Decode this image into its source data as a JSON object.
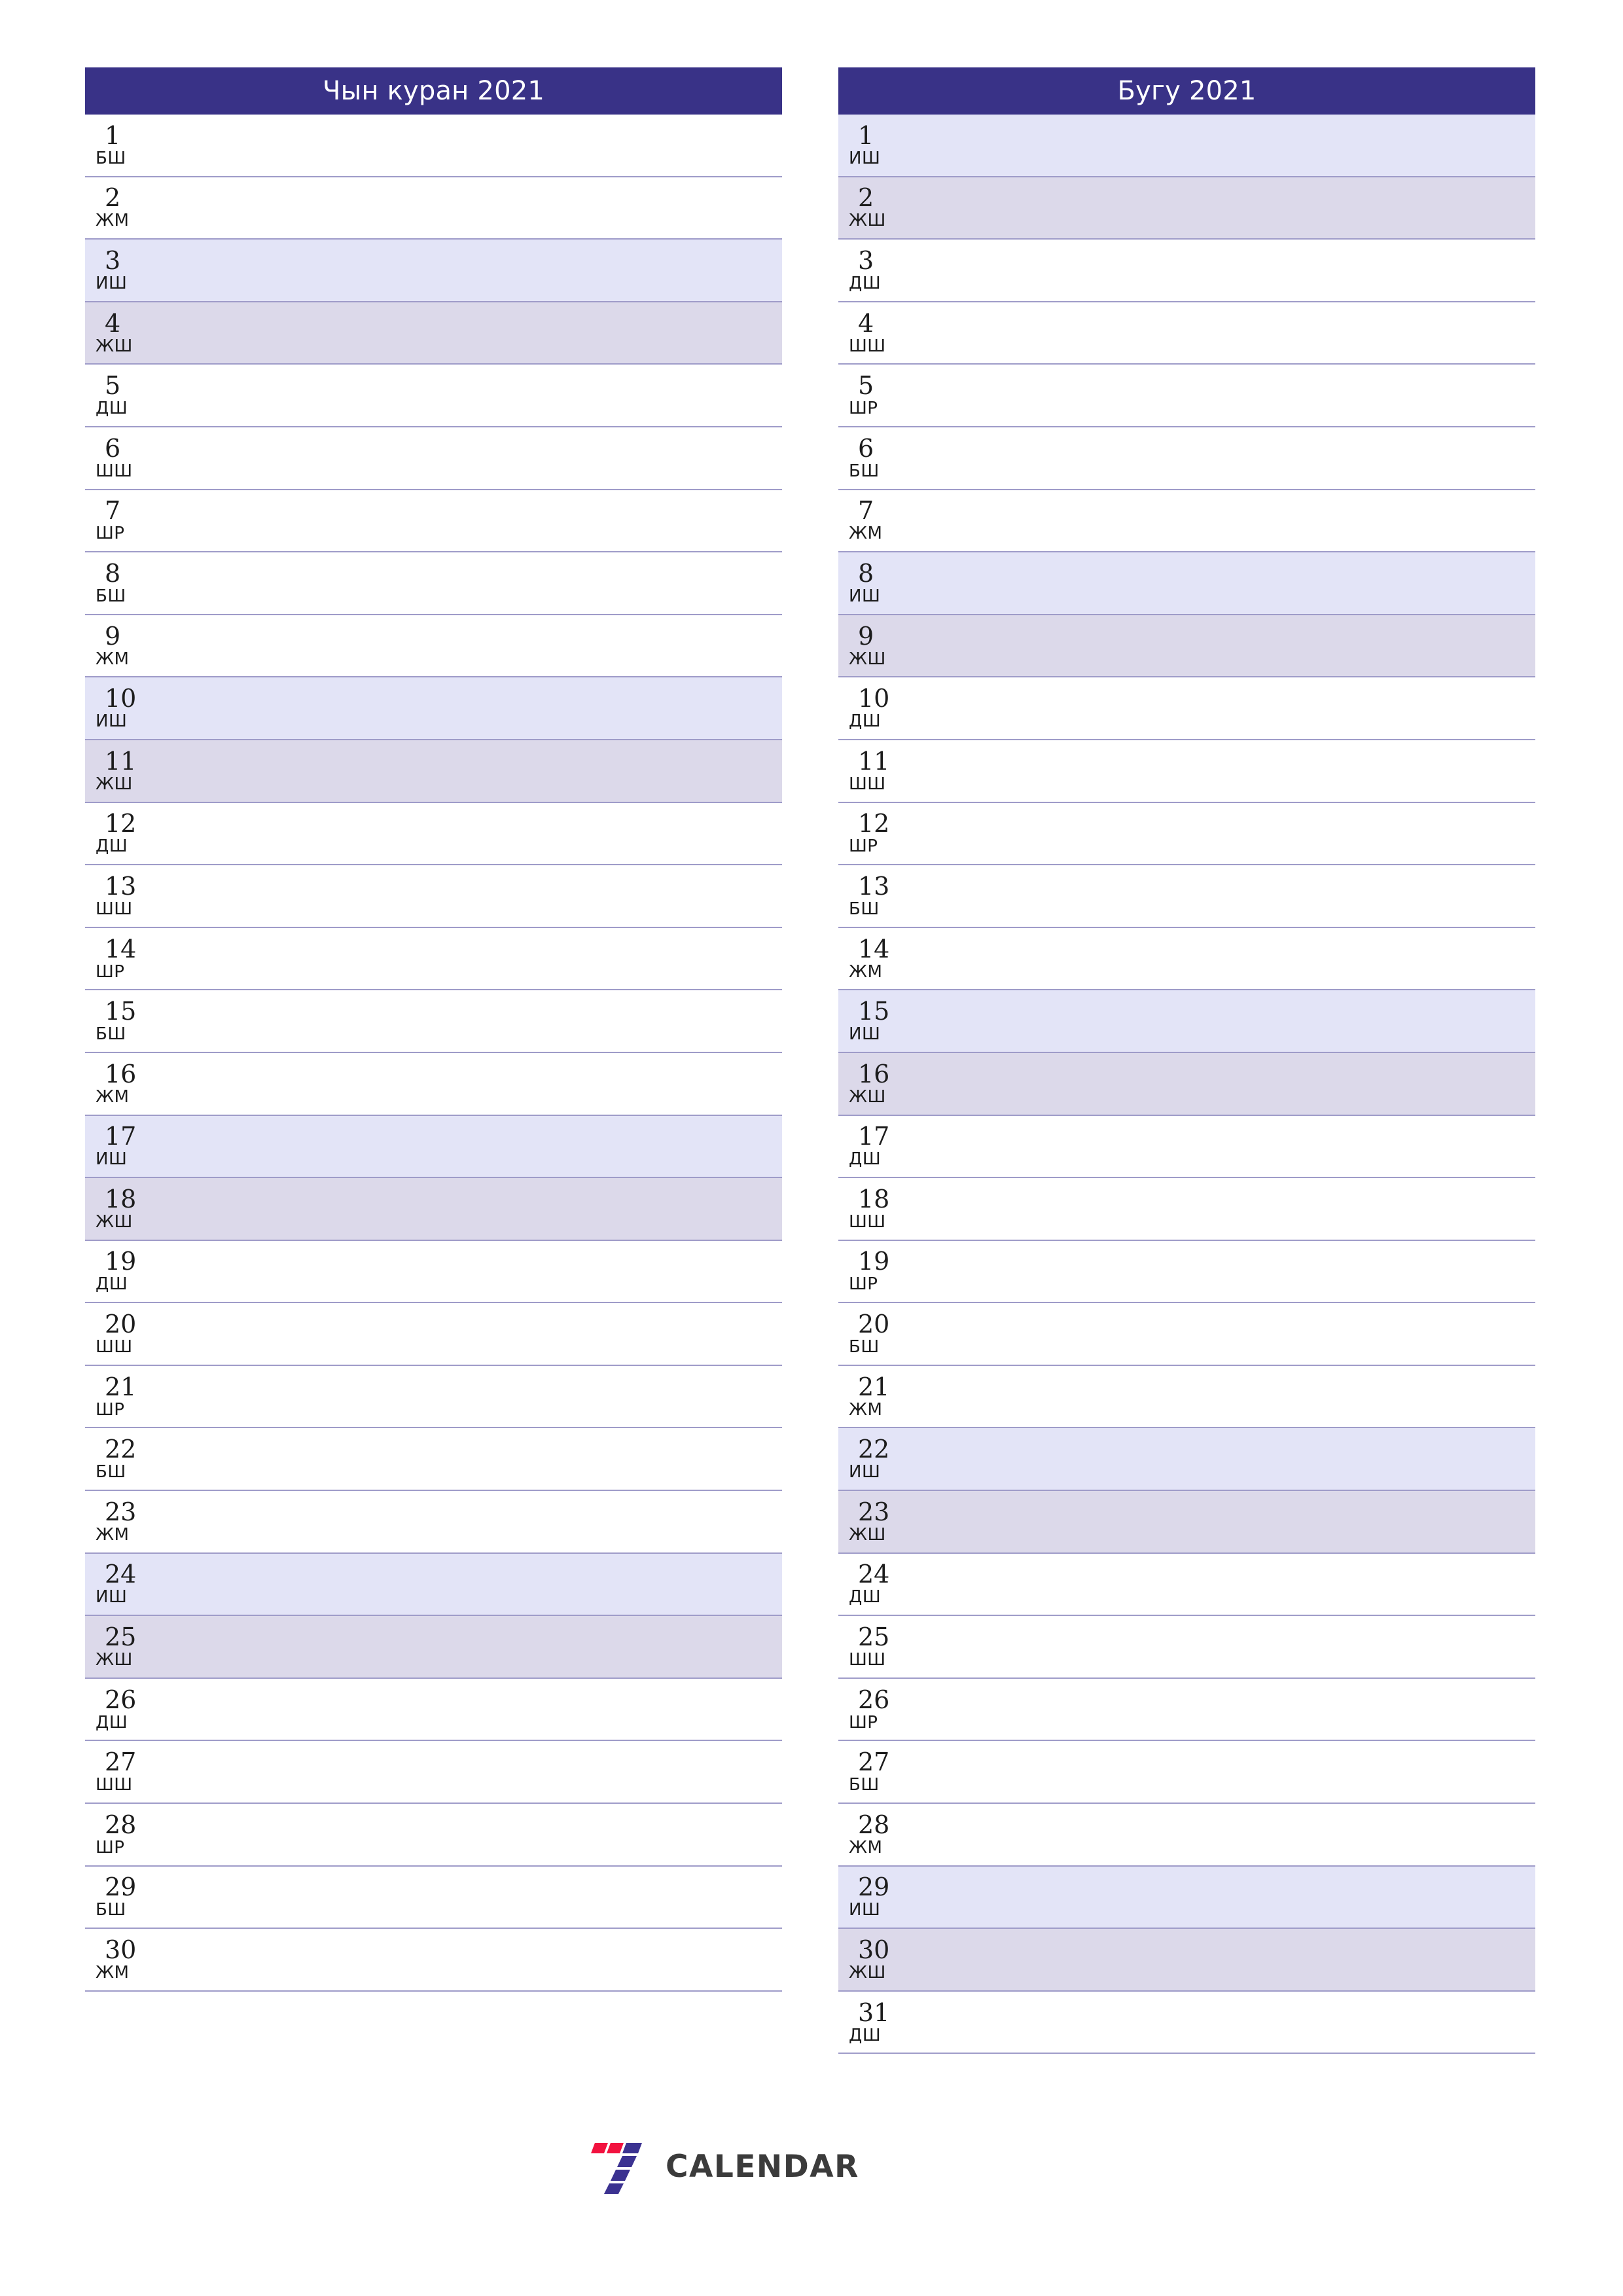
{
  "brand": {
    "name": "CALENDAR",
    "mark_icon": "seven-logo-icon",
    "mark_colors": {
      "red": "#f2123f",
      "blue": "#3b3291"
    }
  },
  "theme": {
    "header_bg": "#393287",
    "header_text": "#ffffff",
    "saturday_bg": "#e3e4f7",
    "sunday_bg": "#dcd9ea",
    "row_border": "#9f9cc9",
    "text": "#1c1c1c"
  },
  "months": [
    {
      "title": "Чын куран 2021",
      "days": [
        {
          "num": "1",
          "wd": "БШ",
          "type": "work"
        },
        {
          "num": "2",
          "wd": "ЖМ",
          "type": "work"
        },
        {
          "num": "3",
          "wd": "ИШ",
          "type": "sat"
        },
        {
          "num": "4",
          "wd": "ЖШ",
          "type": "sun"
        },
        {
          "num": "5",
          "wd": "ДШ",
          "type": "work"
        },
        {
          "num": "6",
          "wd": "ШШ",
          "type": "work"
        },
        {
          "num": "7",
          "wd": "ШР",
          "type": "work"
        },
        {
          "num": "8",
          "wd": "БШ",
          "type": "work"
        },
        {
          "num": "9",
          "wd": "ЖМ",
          "type": "work"
        },
        {
          "num": "10",
          "wd": "ИШ",
          "type": "sat"
        },
        {
          "num": "11",
          "wd": "ЖШ",
          "type": "sun"
        },
        {
          "num": "12",
          "wd": "ДШ",
          "type": "work"
        },
        {
          "num": "13",
          "wd": "ШШ",
          "type": "work"
        },
        {
          "num": "14",
          "wd": "ШР",
          "type": "work"
        },
        {
          "num": "15",
          "wd": "БШ",
          "type": "work"
        },
        {
          "num": "16",
          "wd": "ЖМ",
          "type": "work"
        },
        {
          "num": "17",
          "wd": "ИШ",
          "type": "sat"
        },
        {
          "num": "18",
          "wd": "ЖШ",
          "type": "sun"
        },
        {
          "num": "19",
          "wd": "ДШ",
          "type": "work"
        },
        {
          "num": "20",
          "wd": "ШШ",
          "type": "work"
        },
        {
          "num": "21",
          "wd": "ШР",
          "type": "work"
        },
        {
          "num": "22",
          "wd": "БШ",
          "type": "work"
        },
        {
          "num": "23",
          "wd": "ЖМ",
          "type": "work"
        },
        {
          "num": "24",
          "wd": "ИШ",
          "type": "sat"
        },
        {
          "num": "25",
          "wd": "ЖШ",
          "type": "sun"
        },
        {
          "num": "26",
          "wd": "ДШ",
          "type": "work"
        },
        {
          "num": "27",
          "wd": "ШШ",
          "type": "work"
        },
        {
          "num": "28",
          "wd": "ШР",
          "type": "work"
        },
        {
          "num": "29",
          "wd": "БШ",
          "type": "work"
        },
        {
          "num": "30",
          "wd": "ЖМ",
          "type": "work"
        }
      ]
    },
    {
      "title": "Бугу 2021",
      "days": [
        {
          "num": "1",
          "wd": "ИШ",
          "type": "sat"
        },
        {
          "num": "2",
          "wd": "ЖШ",
          "type": "sun"
        },
        {
          "num": "3",
          "wd": "ДШ",
          "type": "work"
        },
        {
          "num": "4",
          "wd": "ШШ",
          "type": "work"
        },
        {
          "num": "5",
          "wd": "ШР",
          "type": "work"
        },
        {
          "num": "6",
          "wd": "БШ",
          "type": "work"
        },
        {
          "num": "7",
          "wd": "ЖМ",
          "type": "work"
        },
        {
          "num": "8",
          "wd": "ИШ",
          "type": "sat"
        },
        {
          "num": "9",
          "wd": "ЖШ",
          "type": "sun"
        },
        {
          "num": "10",
          "wd": "ДШ",
          "type": "work"
        },
        {
          "num": "11",
          "wd": "ШШ",
          "type": "work"
        },
        {
          "num": "12",
          "wd": "ШР",
          "type": "work"
        },
        {
          "num": "13",
          "wd": "БШ",
          "type": "work"
        },
        {
          "num": "14",
          "wd": "ЖМ",
          "type": "work"
        },
        {
          "num": "15",
          "wd": "ИШ",
          "type": "sat"
        },
        {
          "num": "16",
          "wd": "ЖШ",
          "type": "sun"
        },
        {
          "num": "17",
          "wd": "ДШ",
          "type": "work"
        },
        {
          "num": "18",
          "wd": "ШШ",
          "type": "work"
        },
        {
          "num": "19",
          "wd": "ШР",
          "type": "work"
        },
        {
          "num": "20",
          "wd": "БШ",
          "type": "work"
        },
        {
          "num": "21",
          "wd": "ЖМ",
          "type": "work"
        },
        {
          "num": "22",
          "wd": "ИШ",
          "type": "sat"
        },
        {
          "num": "23",
          "wd": "ЖШ",
          "type": "sun"
        },
        {
          "num": "24",
          "wd": "ДШ",
          "type": "work"
        },
        {
          "num": "25",
          "wd": "ШШ",
          "type": "work"
        },
        {
          "num": "26",
          "wd": "ШР",
          "type": "work"
        },
        {
          "num": "27",
          "wd": "БШ",
          "type": "work"
        },
        {
          "num": "28",
          "wd": "ЖМ",
          "type": "work"
        },
        {
          "num": "29",
          "wd": "ИШ",
          "type": "sat"
        },
        {
          "num": "30",
          "wd": "ЖШ",
          "type": "sun"
        },
        {
          "num": "31",
          "wd": "ДШ",
          "type": "work"
        }
      ]
    }
  ]
}
